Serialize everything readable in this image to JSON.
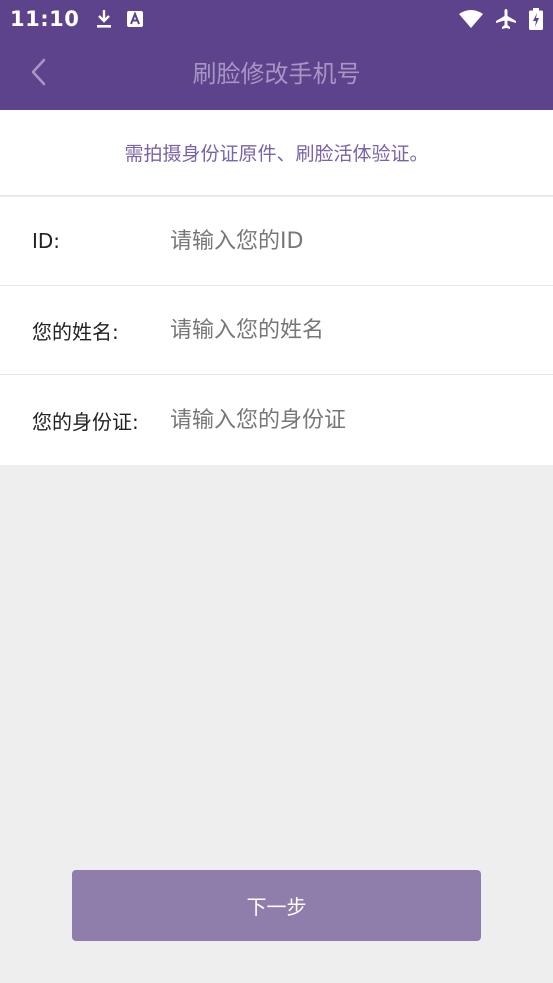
{
  "status_bar": {
    "time": "11:10",
    "icons": [
      "download-icon",
      "font-a-icon",
      "wifi-icon",
      "airplane-icon",
      "battery-charging-icon"
    ]
  },
  "app_bar": {
    "title": "刷脸修改手机号",
    "back_icon": "chevron-left-icon"
  },
  "notice": {
    "text": "需拍摄身份证原件、刷脸活体验证。"
  },
  "form": {
    "fields": [
      {
        "label": "ID:",
        "placeholder": "请输入您的ID",
        "value": ""
      },
      {
        "label": "您的姓名:",
        "placeholder": "请输入您的姓名",
        "value": ""
      },
      {
        "label": "您的身份证:",
        "placeholder": "请输入您的身份证",
        "value": ""
      }
    ]
  },
  "actions": {
    "next_label": "下一步"
  },
  "colors": {
    "primary": "#5d438c",
    "button": "#8f7dac",
    "notice_text": "#7a63a6",
    "background": "#eeeeee"
  }
}
